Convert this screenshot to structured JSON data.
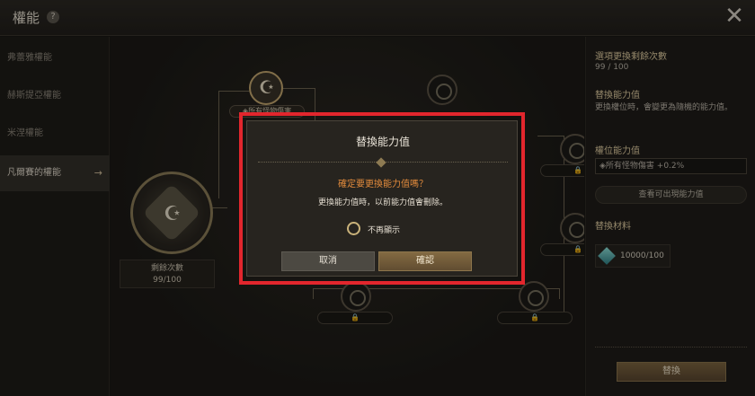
{
  "header": {
    "title": "權能",
    "help_icon": "?",
    "close_icon": "✕"
  },
  "sidebar": {
    "items": [
      {
        "label": "弗蕾雅權能"
      },
      {
        "label": "赫斯提亞權能"
      },
      {
        "label": "米涅權能"
      },
      {
        "label": "凡爾賽的權能",
        "active": true
      }
    ]
  },
  "tree": {
    "remaining_label": "剩餘次數",
    "remaining_value": "99/100",
    "top_node_label": "◈所有怪物傷害"
  },
  "right_panel": {
    "swap_count_title": "選項更換剩餘次數",
    "swap_count_value": "99 / 100",
    "replace_title": "替換能力值",
    "replace_desc": "更換權位時，會變更為隨機的能力值。",
    "slot_title": "權位能力值",
    "slot_value": "◈所有怪物傷害 +0.2%",
    "view_button": "查看可出現能力值",
    "material_title": "替換材料",
    "material_qty": "10000/100",
    "swap_button": "替換"
  },
  "modal": {
    "title": "替換能力值",
    "question": "確定要更換能力值嗎？",
    "description": "更換能力值時，以前能力值會刪除。",
    "checkbox_label": "不再顯示",
    "cancel": "取消",
    "confirm": "確認"
  },
  "colors": {
    "highlight": "#e2262d",
    "accent": "#e38b3c",
    "gold": "#c6aa70"
  }
}
